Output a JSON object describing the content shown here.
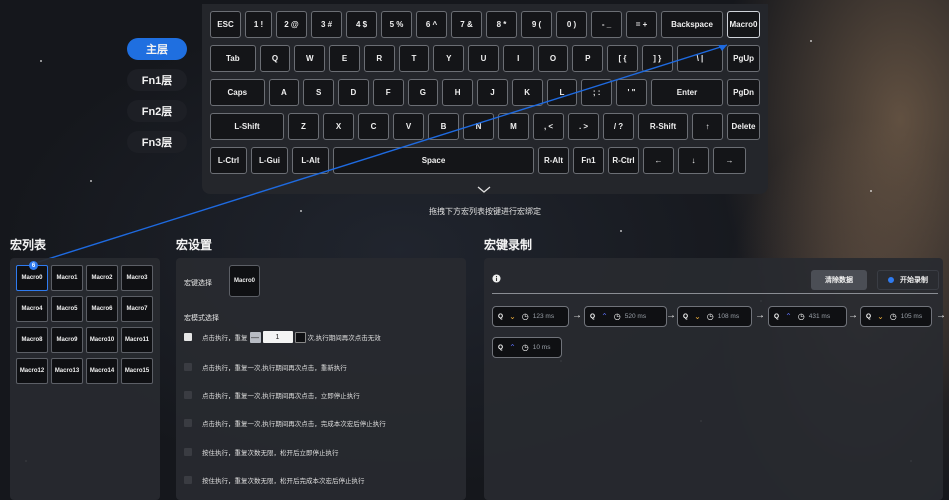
{
  "layers": {
    "items": [
      {
        "label": "主层",
        "active": true
      },
      {
        "label": "Fn1层",
        "active": false
      },
      {
        "label": "Fn2层",
        "active": false
      },
      {
        "label": "Fn3层",
        "active": false
      }
    ]
  },
  "keyboard": {
    "rows": [
      [
        "ESC",
        "1 !",
        "2 @",
        "3 #",
        "4 $",
        "5 %",
        "6 ^",
        "7 &",
        "8 *",
        "9 (",
        "0 )",
        "- _",
        "= +",
        "Backspace",
        "Macro0"
      ],
      [
        "Tab",
        "Q",
        "W",
        "E",
        "R",
        "T",
        "Y",
        "U",
        "I",
        "O",
        "P",
        "[ {",
        "] }",
        "\\ |",
        "PgUp"
      ],
      [
        "Caps",
        "A",
        "S",
        "D",
        "F",
        "G",
        "H",
        "J",
        "K",
        "L",
        "; :",
        "' \"",
        "Enter",
        "PgDn"
      ],
      [
        "L-Shift",
        "Z",
        "X",
        "C",
        "V",
        "B",
        "N",
        "M",
        ", <",
        ". >",
        "/ ?",
        "R-Shift",
        "↑",
        "Delete"
      ],
      [
        "L-Ctrl",
        "L-Gui",
        "L-Alt",
        "Space",
        "R-Alt",
        "Fn1",
        "R-Ctrl",
        "←",
        "↓",
        "→"
      ]
    ],
    "hint": "拖拽下方宏列表按键进行宏绑定"
  },
  "macro_list": {
    "title": "宏列表",
    "badge": "6",
    "rows": [
      [
        "Macro0",
        "Macro1",
        "Macro2",
        "Macro3"
      ],
      [
        "Macro4",
        "Macro5",
        "Macro6",
        "Macro7"
      ],
      [
        "Macro8",
        "Macro9",
        "Macro10",
        "Macro11"
      ],
      [
        "Macro12",
        "Macro13",
        "Macro14",
        "Macro15"
      ]
    ]
  },
  "macro_settings": {
    "title": "宏设置",
    "key_select_label": "宏键选择",
    "selected_key": "Macro0",
    "mode_label": "宏模式选择",
    "option1_prefix": "点击执行，重复",
    "repeat_minus": "—",
    "repeat_value": "1",
    "option1_suffix": "次,执行期间再次点击无效",
    "options": [
      "点击执行，重复一次,执行期间再次点击，重新执行",
      "点击执行，重复一次,执行期间再次点击，立即停止执行",
      "点击执行，重复一次,执行期间再次点击，完成本次宏后停止执行",
      "按住执行，重复次数无限，松开后立即停止执行",
      "按住执行，重复次数无限，松开后完成本次宏后停止执行"
    ]
  },
  "macro_record": {
    "title": "宏键录制",
    "info_icon": "info-icon",
    "clear_label": "清除数据",
    "start_label": "开始录制",
    "steps": [
      {
        "key": "Q",
        "dir": "down",
        "ms": "123 ms"
      },
      {
        "key": "Q",
        "dir": "up",
        "ms": "520 ms"
      },
      {
        "key": "Q",
        "dir": "down",
        "ms": "108 ms"
      },
      {
        "key": "Q",
        "dir": "up",
        "ms": "431 ms"
      },
      {
        "key": "Q",
        "dir": "down",
        "ms": "105 ms"
      },
      {
        "key": "Q",
        "dir": "up",
        "ms": "10 ms"
      }
    ],
    "arrow": "→"
  },
  "colors": {
    "accent": "#1f6fe0",
    "down_arrow": "#e6a93a",
    "up_arrow": "#5b6ef0",
    "clear_button": "#4b4e55"
  }
}
